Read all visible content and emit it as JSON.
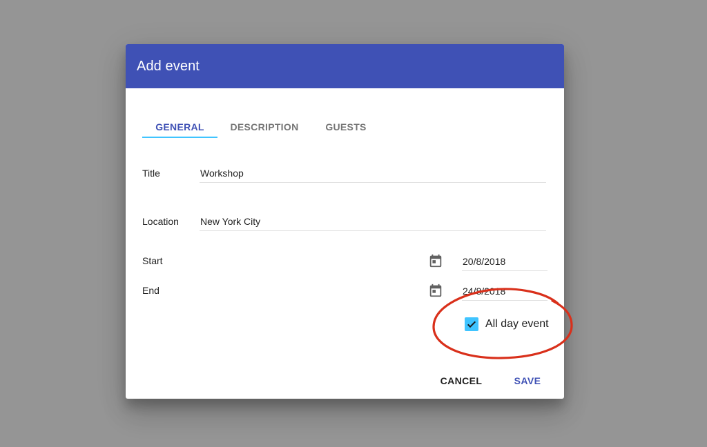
{
  "dialog": {
    "title": "Add event",
    "header_color": "#3f51b5"
  },
  "tabs": [
    {
      "label": "GENERAL",
      "active": true
    },
    {
      "label": "DESCRIPTION",
      "active": false
    },
    {
      "label": "GUESTS",
      "active": false
    }
  ],
  "form": {
    "title_label": "Title",
    "title_value": "Workshop",
    "location_label": "Location",
    "location_value": "New York City",
    "start_label": "Start",
    "start_value": "20/8/2018",
    "end_label": "End",
    "end_value": "24/8/2018",
    "all_day_label": "All day event",
    "all_day_checked": true,
    "calendar_icon": "calendar-icon"
  },
  "actions": {
    "cancel_label": "CANCEL",
    "save_label": "SAVE"
  },
  "colors": {
    "accent": "#40c4ff",
    "primary": "#3f51b5",
    "annotation": "#d9301b",
    "backdrop": "#959595"
  }
}
